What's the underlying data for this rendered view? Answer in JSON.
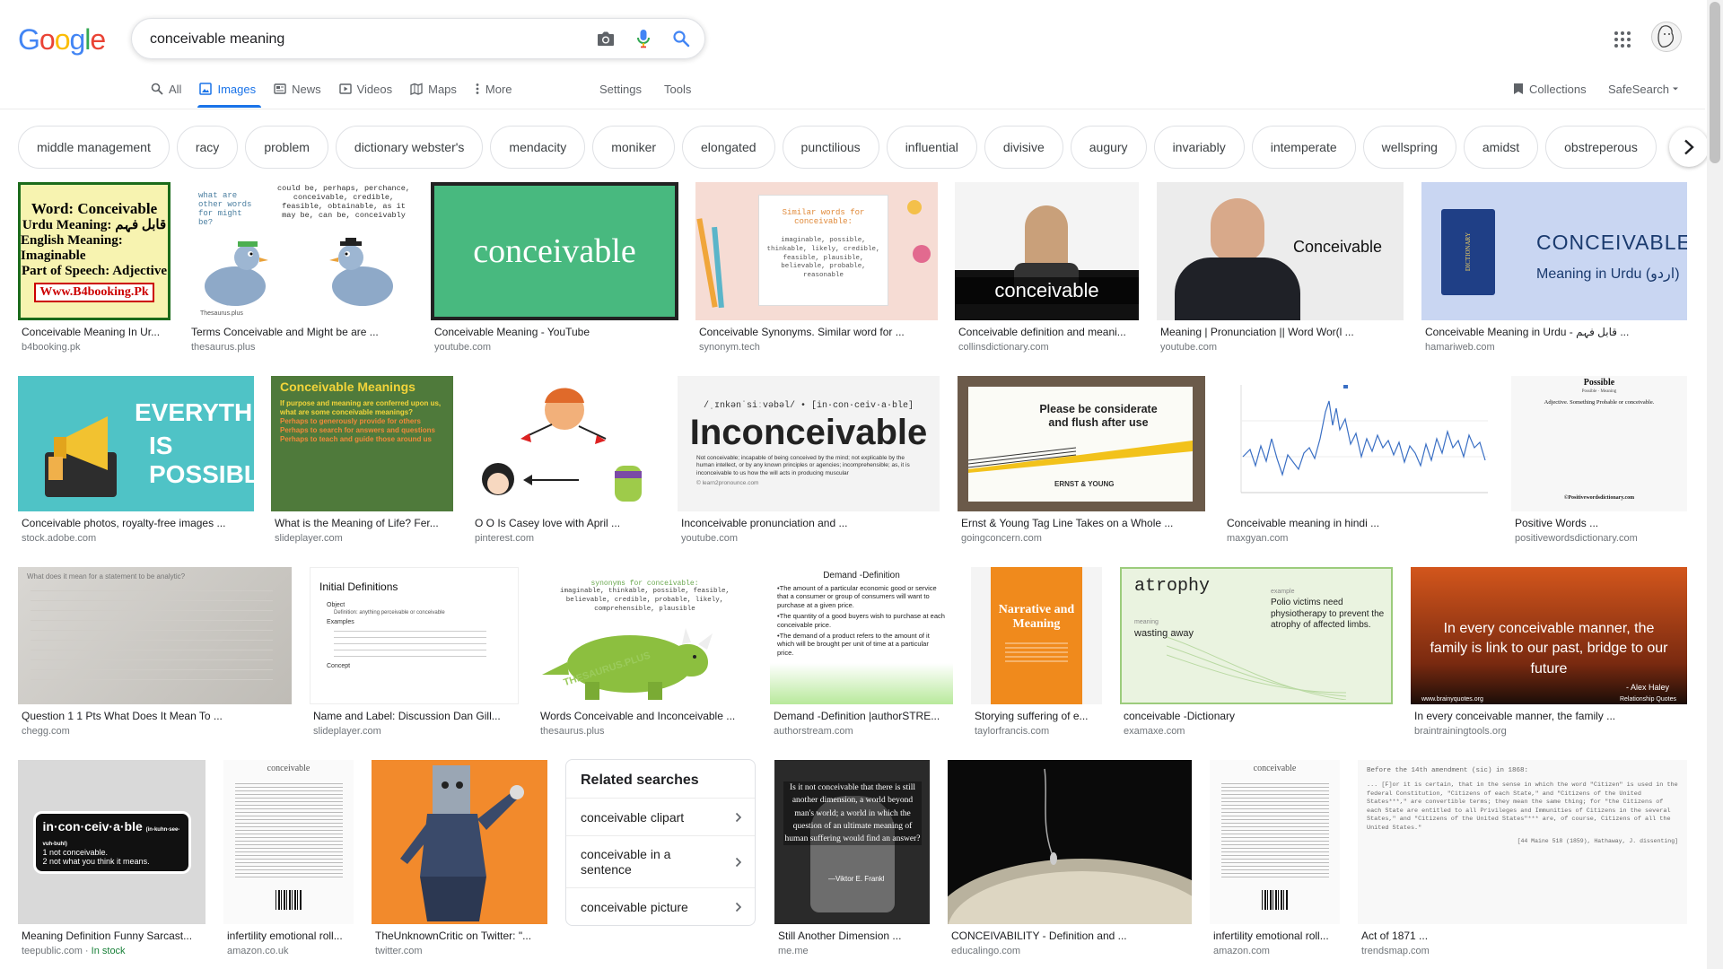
{
  "search": {
    "query": "conceivable meaning",
    "logo_letters": [
      "G",
      "o",
      "o",
      "g",
      "l",
      "e"
    ],
    "logo_colors": [
      "#4285f4",
      "#ea4335",
      "#fbbc05",
      "#4285f4",
      "#34a853",
      "#ea4335"
    ]
  },
  "icons": {
    "camera": "camera-icon",
    "mic": "microphone-icon",
    "search": "search-icon",
    "apps": "apps-grid-icon",
    "avatar": "user-avatar"
  },
  "tabs": [
    {
      "label": "All",
      "icon": "search-icon",
      "active": false
    },
    {
      "label": "Images",
      "icon": "image-icon",
      "active": true
    },
    {
      "label": "News",
      "icon": "news-icon",
      "active": false
    },
    {
      "label": "Videos",
      "icon": "video-icon",
      "active": false
    },
    {
      "label": "Maps",
      "icon": "map-icon",
      "active": false
    },
    {
      "label": "More",
      "icon": "more-vert-icon",
      "active": false
    }
  ],
  "tools": {
    "settings": "Settings",
    "tools": "Tools",
    "collections": "Collections",
    "safesearch": "SafeSearch"
  },
  "chips": [
    "middle management",
    "racy",
    "problem",
    "dictionary webster's",
    "mendacity",
    "moniker",
    "elongated",
    "punctilious",
    "influential",
    "divisive",
    "augury",
    "invariably",
    "intemperate",
    "wellspring",
    "amidst",
    "obstreperous"
  ],
  "results": {
    "row1": [
      {
        "title": "Conceivable Meaning In Ur...",
        "source": "b4booking.pk",
        "thumb": {
          "l1": "Word: Conceivable",
          "l2": "Urdu Meaning: قابل فہم",
          "l3": "English Meaning: Imaginable",
          "l4": "Part of Speech: Adjective",
          "l5": "Www.B4booking.Pk"
        }
      },
      {
        "title": "Terms Conceivable and Might be are ...",
        "source": "thesaurus.plus",
        "thumb": {
          "l1": "what are other words for might be?",
          "l2": "could be, perhaps, perchance, conceivable, credible, feasible, obtainable, as it may be, can be, conceivably",
          "l3": "Thesaurus.plus"
        }
      },
      {
        "title": "Conceivable Meaning - YouTube",
        "source": "youtube.com",
        "thumb": {
          "l1": "conceivable"
        }
      },
      {
        "title": "Conceivable Synonyms. Similar word for ...",
        "source": "synonym.tech",
        "thumb": {
          "l1": "Similar words for conceivable:",
          "l2": "imaginable, possible, thinkable, likely, credible, feasible, plausible, believable, probable, reasonable"
        }
      },
      {
        "title": "Conceivable definition and meani...",
        "source": "collinsdictionary.com",
        "thumb": {
          "l1": "conceivable"
        }
      },
      {
        "title": "Meaning | Pronunciation || Word Wor(l ...",
        "source": "youtube.com",
        "thumb": {
          "l1": "Conceivable"
        }
      },
      {
        "title": "Conceivable Meaning in Urdu - قابل فہم ...",
        "source": "hamariweb.com",
        "thumb": {
          "l1": "CONCEIVABLE",
          "l2": "Meaning in Urdu (اردو)",
          "l3": "DICTIONARY"
        }
      }
    ],
    "row2": [
      {
        "title": "Conceivable photos, royalty-free images ...",
        "source": "stock.adobe.com",
        "thumb": {
          "l1": "EVERYTHING",
          "l2": "IS POSSIBLE"
        }
      },
      {
        "title": "What is the Meaning of Life? Fer...",
        "source": "slideplayer.com",
        "thumb": {
          "l1": "Conceivable Meanings",
          "l2": "If purpose and meaning are conferred upon us, what are some conceivable meanings?",
          "l3": "Perhaps to generously provide for others",
          "l4": "Perhaps to search for answers and questions",
          "l5": "Perhaps to teach and guide those around us"
        }
      },
      {
        "title": "O O Is Casey love with April ...",
        "source": "pinterest.com",
        "thumb": {}
      },
      {
        "title": "Inconceivable pronunciation and ...",
        "source": "youtube.com",
        "thumb": {
          "l1": "/ˌɪnkənˈsiːvəbəl/ • [in·con·ceiv·a·ble]",
          "l2": "Inconceivable",
          "l3": "Not conceivable; incapable of being conceived by the mind; not explicable by the human intellect, or by any known principles or agencies; incomprehensible; as, it is inconceivable to us how the will acts in producing muscular",
          "l4": "© learn2pronounce.com"
        }
      },
      {
        "title": "Ernst & Young Tag Line Takes on a Whole ...",
        "source": "goingconcern.com",
        "thumb": {
          "l1": "Please be considerate and flush after use",
          "l2": "ERNST & YOUNG"
        }
      },
      {
        "title": "Conceivable meaning in hindi ...",
        "source": "maxgyan.com",
        "thumb": {}
      },
      {
        "title": "Positive Words ...",
        "source": "positivewordsdictionary.com",
        "thumb": {
          "l1": "Possible",
          "l2": "Possible · Meaning",
          "l3": "Adjective. Something Probable or conceivable.",
          "l4": "©Positivewordsdictionary.com"
        }
      }
    ],
    "row3": [
      {
        "title": "Question 1 1 Pts What Does It Mean To ...",
        "source": "chegg.com",
        "thumb": {
          "l1": "What does it mean for a statement to be analytic?"
        }
      },
      {
        "title": "Name and Label: Discussion Dan Gill...",
        "source": "slideplayer.com",
        "thumb": {
          "l1": "Initial Definitions",
          "l2": "Object",
          "l3": "Definition: anything perceivable or conceivable",
          "l4": "Examples",
          "l5": "Concept"
        }
      },
      {
        "title": "Words Conceivable and Inconceivable ...",
        "source": "thesaurus.plus",
        "thumb": {
          "l1": "synonyms for conceivable:",
          "l2": "imaginable, thinkable, possible, feasible, believable, credible, probable, likely, comprehensible, plausible",
          "l3": "THESAURUS.PLUS"
        }
      },
      {
        "title": "Demand -Definition |authorSTRE...",
        "source": "authorstream.com",
        "thumb": {
          "l1": "Demand -Definition",
          "l2": "•The amount of a particular economic good or service that a consumer or group of consumers will want to purchase at a given price.",
          "l3": "•The quantity of a good buyers wish to purchase at each conceivable price.",
          "l4": "•The demand of a product refers to the amount of it which will be brought per unit of time at a particular price."
        }
      },
      {
        "title": "Storying suffering of e...",
        "source": "taylorfrancis.com",
        "thumb": {
          "l1": "Narrative and Meaning"
        }
      },
      {
        "title": "conceivable -Dictionary",
        "source": "examaxe.com",
        "thumb": {
          "l1": "atrophy",
          "l2": "meaning",
          "l3": "wasting away",
          "l4": "example",
          "l5": "Polio victims need physiotherapy to prevent the atrophy of affected limbs."
        }
      },
      {
        "title": "In every conceivable manner, the family ...",
        "source": "braintrainingtools.org",
        "thumb": {
          "l1": "In every conceivable manner, the family is link to our past, bridge to our future",
          "l2": "- Alex Haley",
          "l3": "www.brainyquotes.org",
          "l4": "Relationship Quotes"
        }
      }
    ],
    "row4": [
      {
        "title": "Meaning Definition Funny Sarcast...",
        "source": "teepublic.com",
        "stock": "In stock",
        "thumb": {
          "l1": "in·con·ceiv·a·ble",
          "l2": "(in-kuhn-see-vuh-buhl)",
          "l3": "1 not conceivable.",
          "l4": "2 not what you think it means."
        }
      },
      {
        "title": "infertility emotional roll...",
        "source": "amazon.co.uk",
        "thumb": {
          "l1": "conceivable"
        }
      },
      {
        "title": "TheUnknownCritic on Twitter: \"...",
        "source": "twitter.com",
        "thumb": {}
      },
      {
        "title": "Still Another Dimension ...",
        "source": "me.me",
        "thumb": {
          "l1": "Is it not conceivable that there is still another dimension, a world beyond man's world; a world in which the question of an ultimate meaning of human suffering would find an answer?",
          "l2": "—Viktor E. Frankl"
        }
      },
      {
        "title": "CONCEIVABILITY - Definition and ...",
        "source": "educalingo.com",
        "thumb": {}
      },
      {
        "title": "infertility emotional roll...",
        "source": "amazon.com",
        "thumb": {
          "l1": "conceivable"
        }
      },
      {
        "title": "Act of 1871 ...",
        "source": "trendsmap.com",
        "thumb": {
          "l1": "Before the 14th amendment (sic) in 1868:",
          "l2": "... [F]or it is certain, that in the sense in which the word \"Citizen\" is used in the federal Constitution, \"Citizens of each State,\" and \"Citizens of the United States***,\" are convertible terms; they mean the same thing; for \"the Citizens of each State are entitled to all Privileges and Immunities of Citizens in the several States,\" and \"Citizens of the United States\"*** are, of course, Citizens of all the United States.\"",
          "l3": "[44 Maine 518 (1859), Hathaway, J. dissenting]"
        }
      }
    ]
  },
  "related": {
    "title": "Related searches",
    "items": [
      "conceivable clipart",
      "conceivable in a sentence",
      "conceivable picture"
    ]
  }
}
